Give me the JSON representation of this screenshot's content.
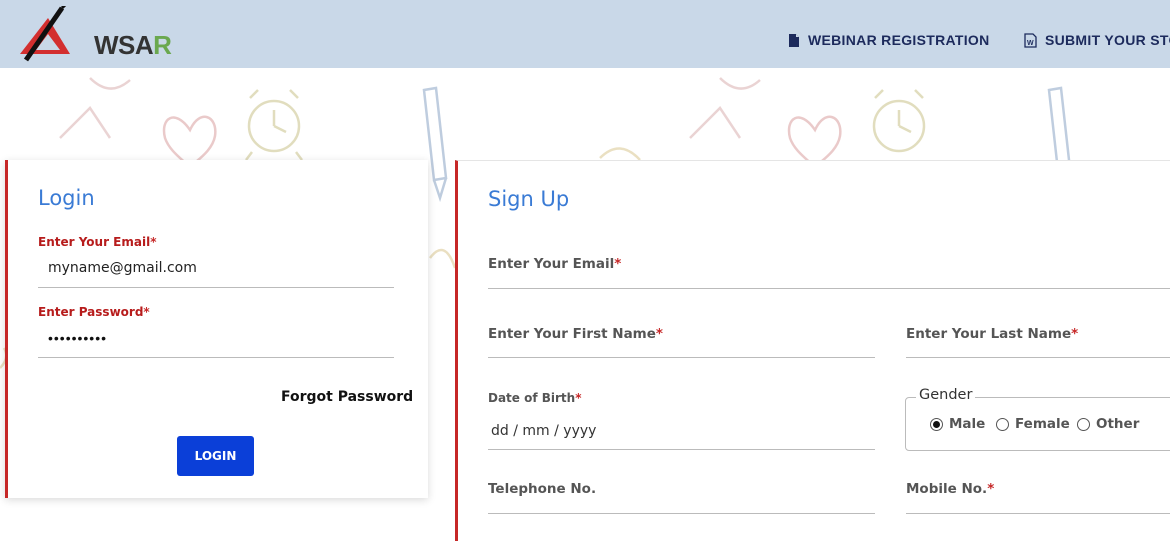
{
  "header": {
    "logo_text_main": "WSA",
    "logo_text_accent": "R",
    "nav": [
      {
        "label": "WEBINAR REGISTRATION",
        "icon": "document-icon"
      },
      {
        "label": "SUBMIT YOUR STORY",
        "icon": "word-document-icon"
      }
    ]
  },
  "login": {
    "title": "Login",
    "email_label": "Enter Your Email",
    "email_value": "myname@gmail.com",
    "password_label": "Enter Password",
    "password_value": "••••••••••",
    "required_marker": "*",
    "forgot_label": "Forgot Password",
    "login_button": "LOGIN"
  },
  "signup": {
    "title": "Sign Up",
    "email_label": "Enter Your Email",
    "first_name_label": "Enter Your First Name",
    "last_name_label": "Enter Your Last Name",
    "dob_label": "Date of Birth",
    "dob_placeholder": "dd / mm / yyyy",
    "gender_legend": "Gender",
    "gender_options": [
      "Male",
      "Female",
      "Other"
    ],
    "gender_selected": "Male",
    "telephone_label": "Telephone No.",
    "mobile_label": "Mobile No.",
    "required_marker": "*"
  },
  "colors": {
    "header_bg": "#c9d8e8",
    "title_blue": "#3a7bd5",
    "required_red": "#c62828",
    "button_blue": "#0b3fd8",
    "nav_text": "#1c2a5c"
  }
}
